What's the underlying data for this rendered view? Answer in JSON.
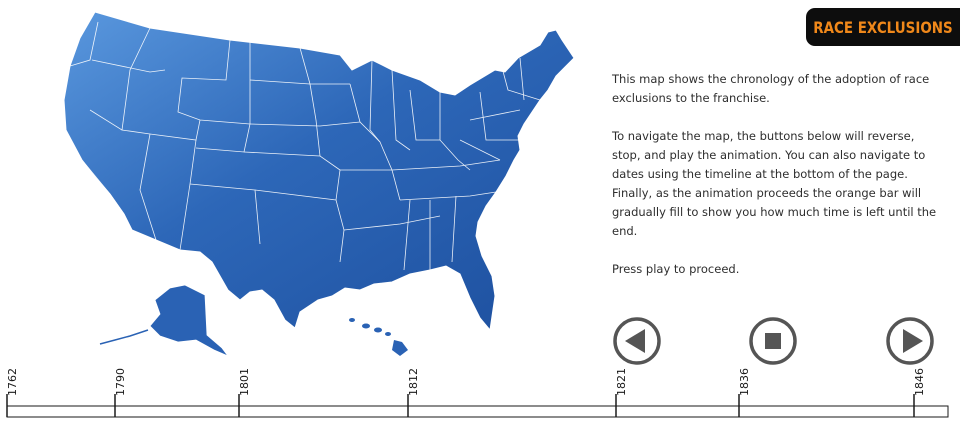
{
  "header": {
    "title": "RACE EXCLUSIONS"
  },
  "description": {
    "p1": "This map shows the chronology of the adoption of race exclusions to the franchise.",
    "p2": "To navigate the map, the buttons below will reverse, stop, and play the animation. You can also navigate to dates using the timeline at the bottom of the page.  Finally, as the animation proceeds the orange bar will gradually fill to show you how much time is left until the end.",
    "p3": "Press play to proceed."
  },
  "controls": {
    "reverse_icon": "reverse-icon",
    "stop_icon": "stop-icon",
    "play_icon": "play-icon"
  },
  "timeline": {
    "years": [
      "1762",
      "1790",
      "1801",
      "1812",
      "1821",
      "1836",
      "1846"
    ],
    "progress": 0
  },
  "colors": {
    "map_fill": "#2a62b4",
    "map_border": "#ffffff",
    "badge_bg": "#0d0d0d",
    "badge_text": "#f0881a",
    "control": "#555555",
    "progress_fill": "#f0881a"
  }
}
